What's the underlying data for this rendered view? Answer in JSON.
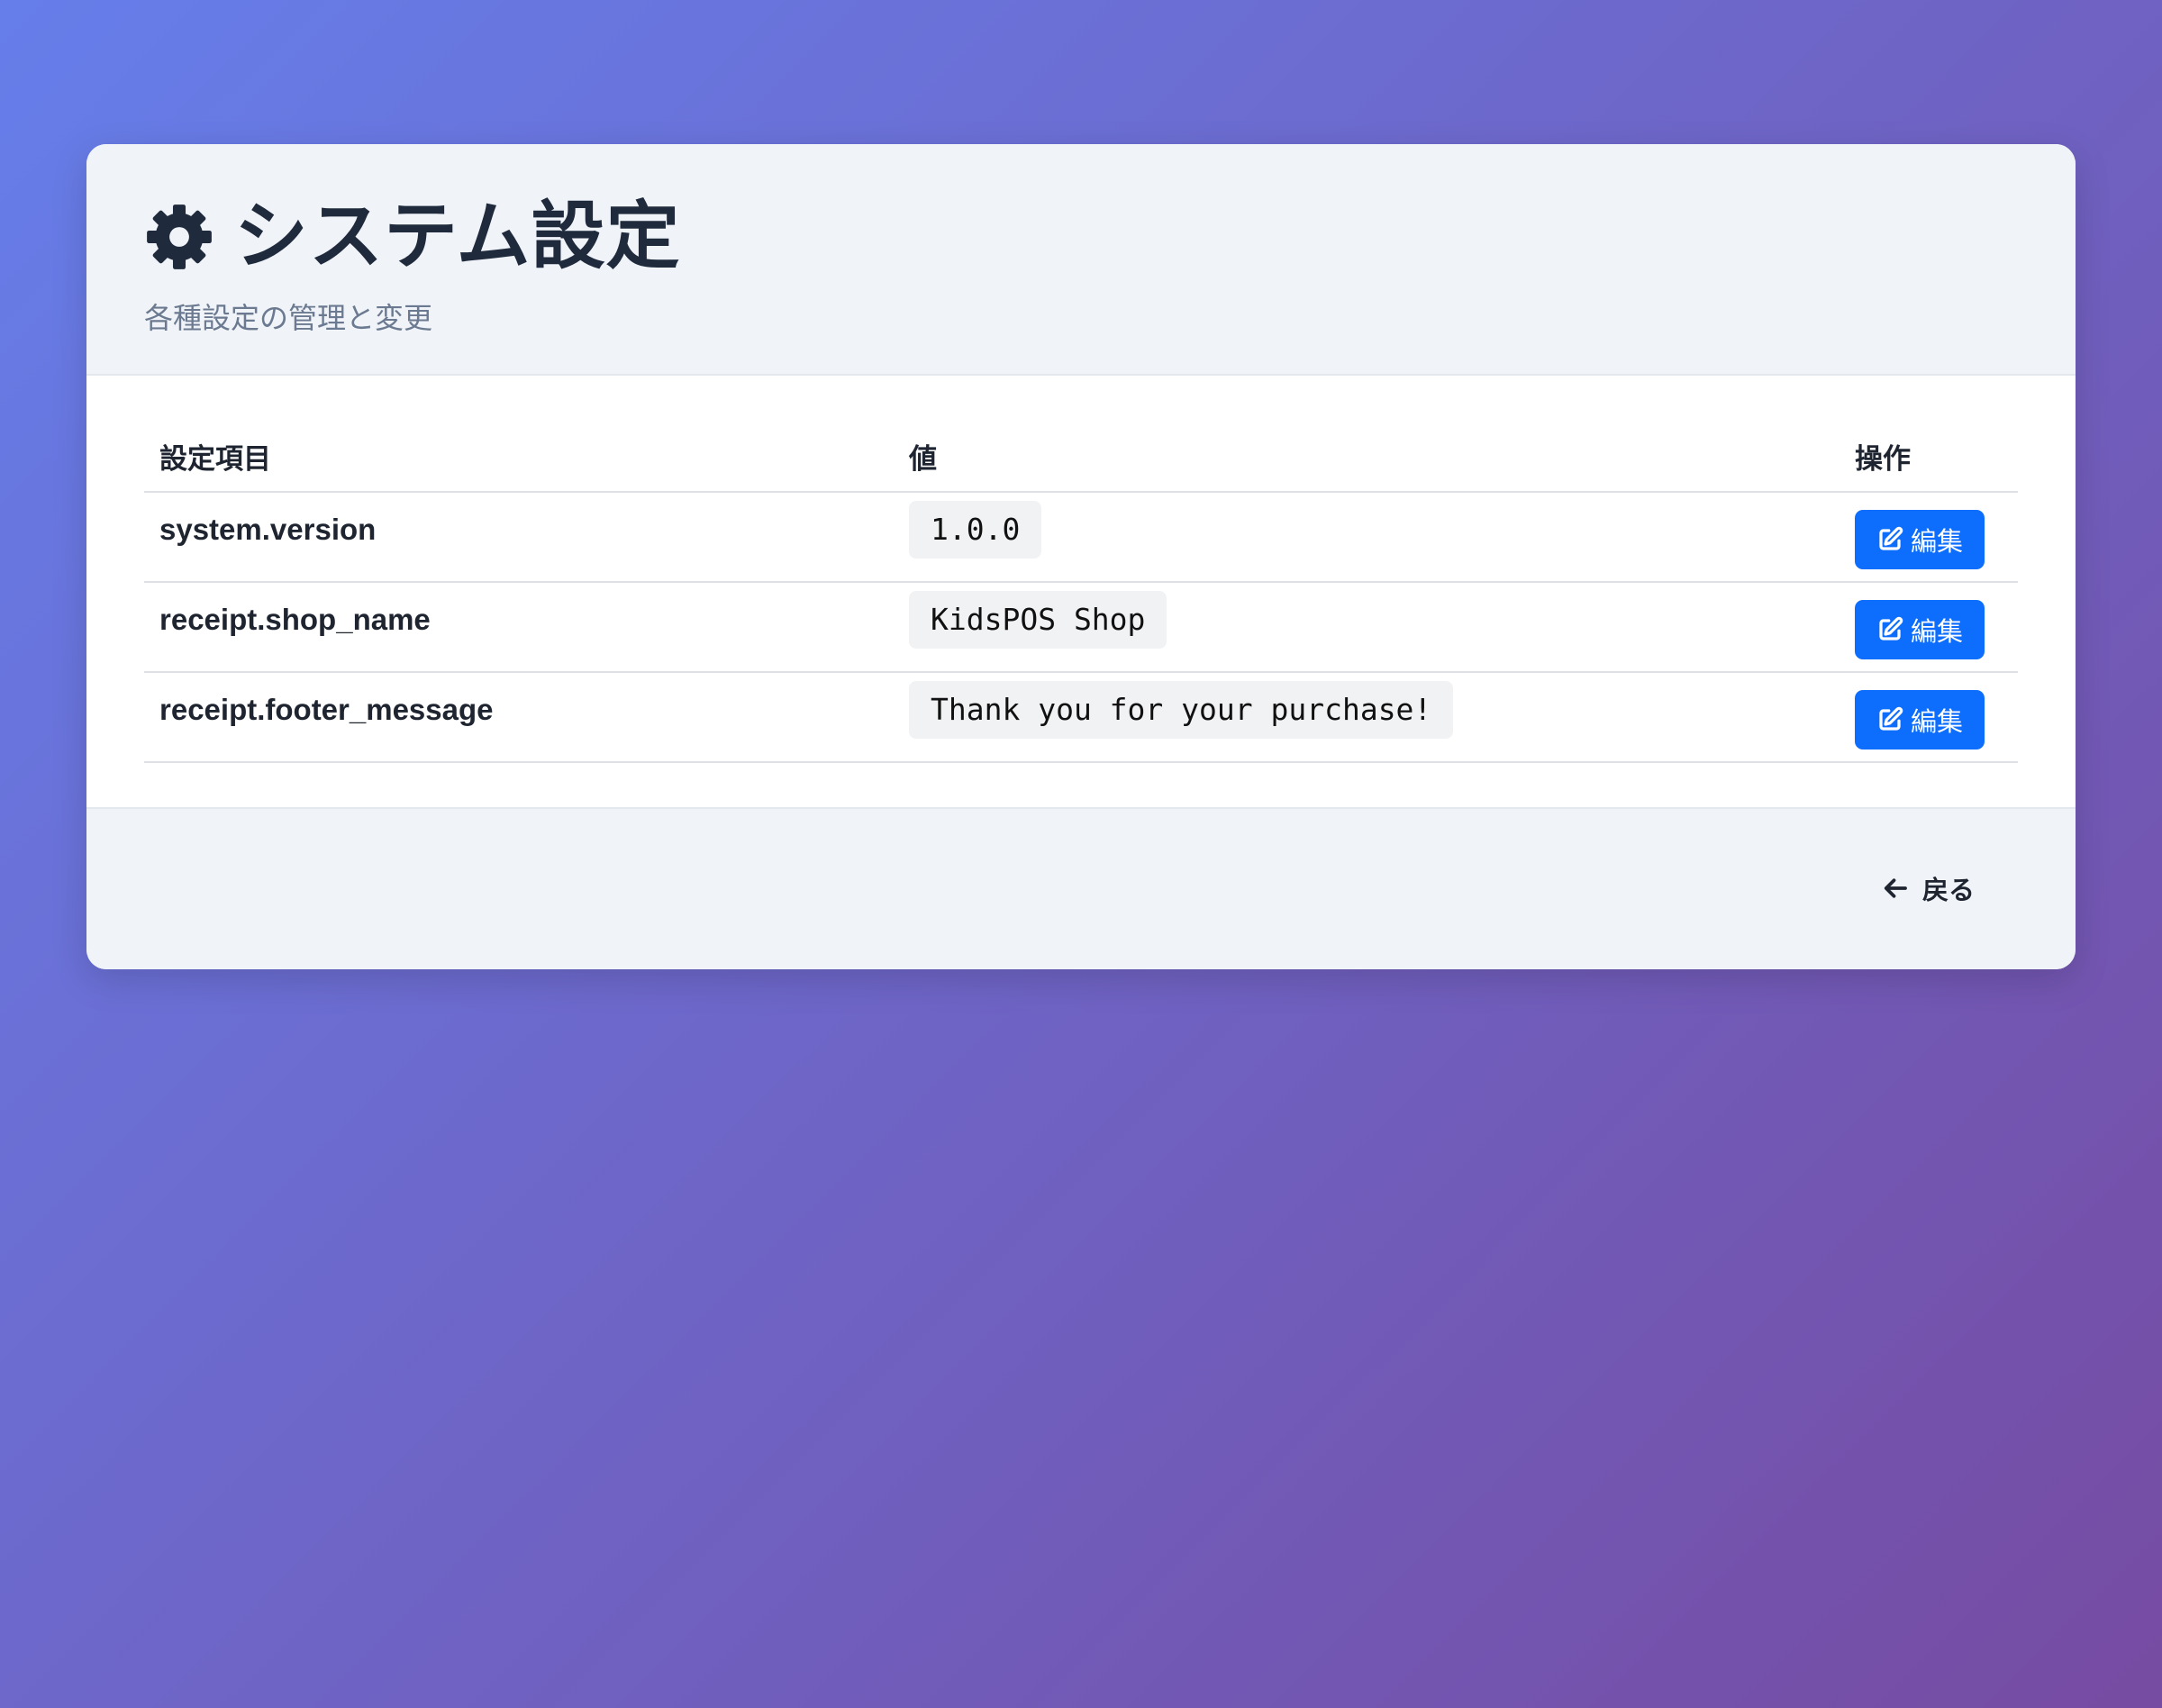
{
  "header": {
    "title": "システム設定",
    "subtitle": "各種設定の管理と変更",
    "icon": "gear-icon"
  },
  "table": {
    "columns": [
      "設定項目",
      "値",
      "操作"
    ],
    "rows": [
      {
        "key": "system.version",
        "value": "1.0.0",
        "action_label": "編集"
      },
      {
        "key": "receipt.shop_name",
        "value": "KidsPOS Shop",
        "action_label": "編集"
      },
      {
        "key": "receipt.footer_message",
        "value": "Thank you for your purchase!",
        "action_label": "編集"
      }
    ]
  },
  "footer": {
    "back_label": "戻る",
    "back_icon": "arrow-left-icon"
  },
  "colors": {
    "background_start": "#667eea",
    "background_end": "#764ba2",
    "primary": "#0d6efd",
    "panel": "#f0f3f8",
    "text_dark": "#1f2a3c",
    "text_muted": "#6b7a90"
  }
}
